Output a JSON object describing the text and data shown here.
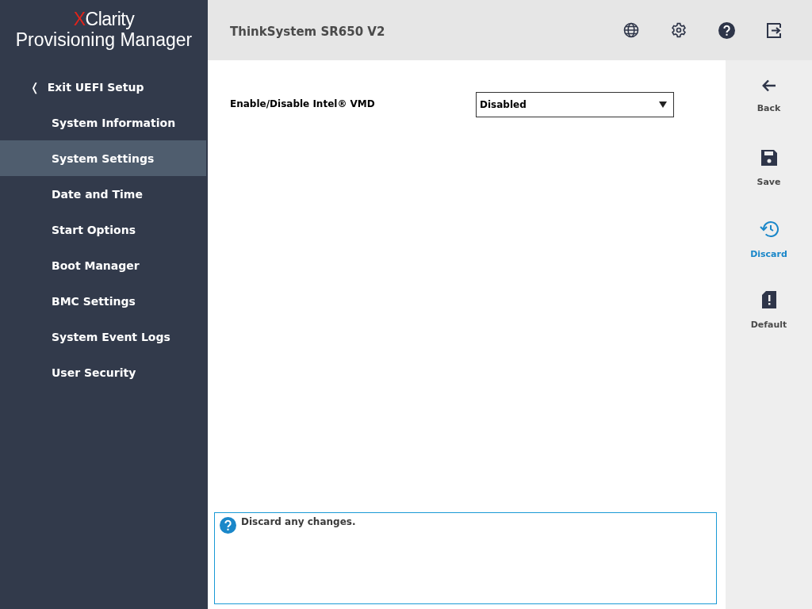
{
  "logo": {
    "accent": "X",
    "name": "Clarity",
    "subtitle": "Provisioning Manager"
  },
  "sidebar": {
    "exit": {
      "icon": "❬",
      "label": "Exit UEFI Setup"
    },
    "items": [
      {
        "label": "System Information",
        "selected": false
      },
      {
        "label": "System Settings",
        "selected": true
      },
      {
        "label": "Date and Time",
        "selected": false
      },
      {
        "label": "Start Options",
        "selected": false
      },
      {
        "label": "Boot Manager",
        "selected": false
      },
      {
        "label": "BMC Settings",
        "selected": false
      },
      {
        "label": "System Event Logs",
        "selected": false
      },
      {
        "label": "User Security",
        "selected": false
      }
    ]
  },
  "header": {
    "title": "ThinkSystem SR650 V2",
    "icons": [
      {
        "kind": "globe"
      },
      {
        "kind": "settings"
      },
      {
        "kind": "help"
      },
      {
        "kind": "exit"
      }
    ]
  },
  "settings": [
    {
      "label": "Enable/Disable Intel® VMD",
      "value": "Disabled"
    }
  ],
  "actions": [
    {
      "kind": "back",
      "label": "Back",
      "highlighted": false
    },
    {
      "kind": "save",
      "label": "Save",
      "highlighted": false
    },
    {
      "kind": "discard",
      "label": "Discard",
      "highlighted": true
    },
    {
      "kind": "default",
      "label": "Default",
      "highlighted": false
    }
  ],
  "help": {
    "text": "Discard any changes."
  }
}
